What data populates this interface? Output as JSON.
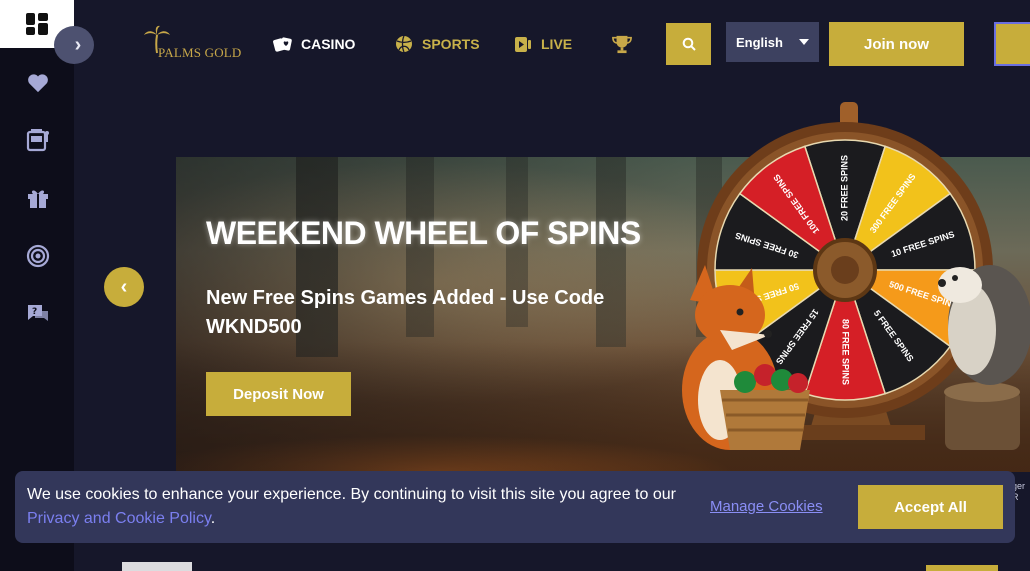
{
  "sidebar": {
    "items": [
      {
        "icon": "grid-menu-icon"
      },
      {
        "icon": "heart-icon"
      },
      {
        "icon": "slot-machine-icon"
      },
      {
        "icon": "gift-icon"
      },
      {
        "icon": "target-icon"
      },
      {
        "icon": "help-chat-icon"
      }
    ],
    "collapse_label": "›"
  },
  "header": {
    "logo_text": "PALMS GOLD",
    "nav": [
      {
        "label": "CASINO",
        "icon": "cards-icon"
      },
      {
        "label": "SPORTS",
        "icon": "ball-icon"
      },
      {
        "label": "LIVE",
        "icon": "live-icon"
      },
      {
        "label": "",
        "icon": "trophy-icon"
      }
    ],
    "language": "English",
    "join_label": "Join now"
  },
  "banner": {
    "title": "WEEKEND WHEEL OF SPINS",
    "subtitle": "New Free Spins Games Added - Use Code WKND500",
    "cta_label": "Deposit Now",
    "prev_label": "‹",
    "wheel_segments": [
      "20 FREE SPINS",
      "300 FREE SPINS",
      "10 FREE SPINS",
      "500 FREE SPINS",
      "5 FREE SPINS",
      "80 FREE SPINS",
      "15 FREE SPINS",
      "50 FREE SPINS",
      "30 FREE SPINS",
      "100 FREE SPINS"
    ]
  },
  "cookie": {
    "text_before": "We use cookies to enhance your experience. By continuing to visit this site you agree to our ",
    "policy_link": "Privacy and Cookie Policy",
    "text_after": ".",
    "manage_label": "Manage Cookies",
    "accept_label": "Accept All"
  },
  "side_fragment": "ger\nR",
  "colors": {
    "gold": "#c7ad3b",
    "background": "#16172a",
    "sidebar": "#0d0d1a",
    "link": "#7b7ff0"
  }
}
